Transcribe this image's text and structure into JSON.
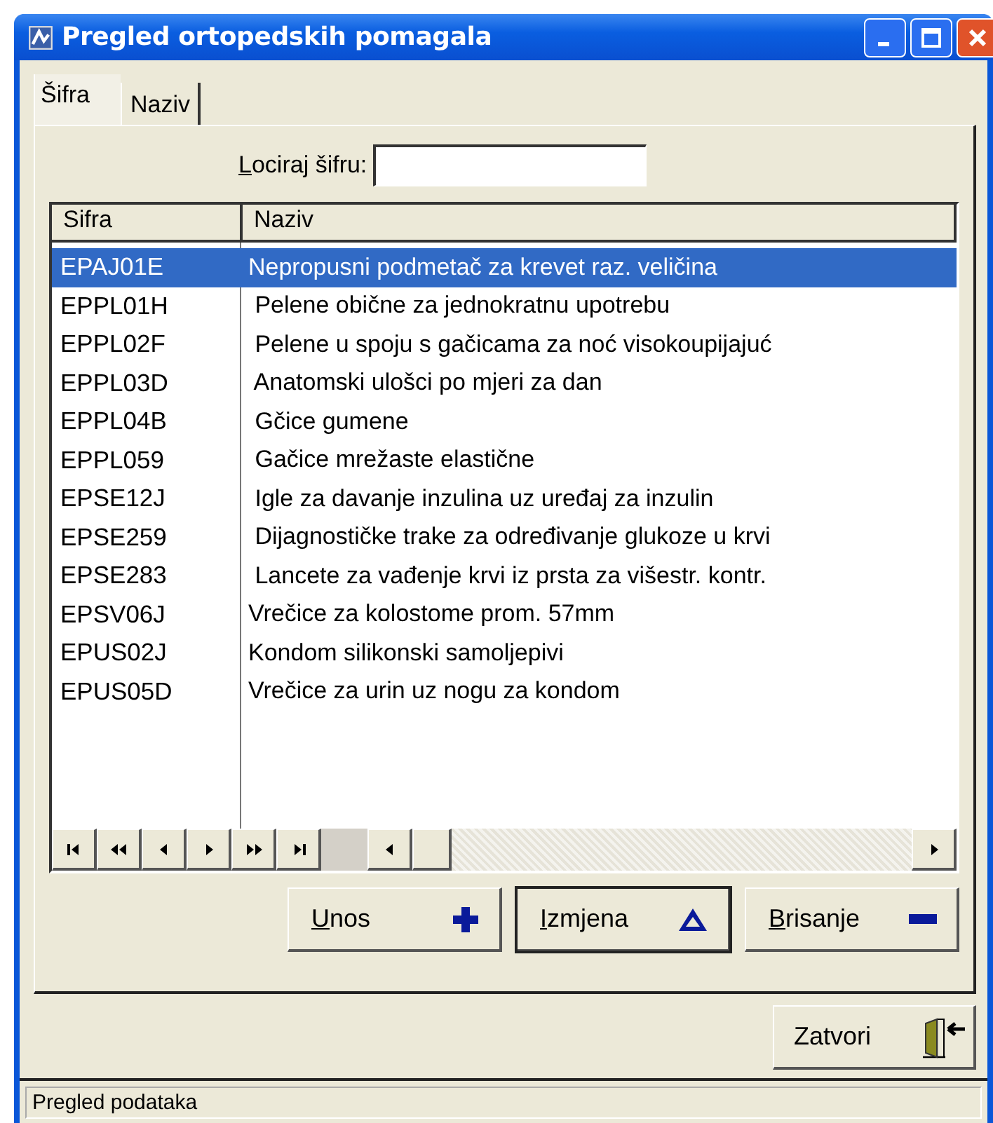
{
  "window": {
    "title": "Pregled ortopedskih pomagala"
  },
  "tabs": [
    {
      "label": "Šifra",
      "selected": true
    },
    {
      "label": "Naziv",
      "selected": false
    }
  ],
  "locate": {
    "label": "Lociraj šifru:"
  },
  "grid": {
    "columns": [
      "Sifra",
      "Naziv"
    ],
    "rows": [
      {
        "code": "EPAJ01E",
        "name": "Nepropusni podmetač za krevet raz. veličina",
        "selected": true
      },
      {
        "code": "EPPL01H",
        "name": " Pelene obične za jednokratnu upotrebu",
        "selected": false
      },
      {
        "code": "EPPL02F",
        "name": " Pelene u spoju s gačicama za noć visokoupijajuć",
        "selected": false
      },
      {
        "code": "EPPL03D",
        "name": " Anatomski ulošci po mjeri za dan",
        "selected": false
      },
      {
        "code": "EPPL04B",
        "name": " Gčice gumene",
        "selected": false
      },
      {
        "code": "EPPL059",
        "name": " Gačice mrežaste elastične",
        "selected": false
      },
      {
        "code": "EPSE12J",
        "name": " Igle za davanje inzulina uz uređaj za inzulin",
        "selected": false
      },
      {
        "code": "EPSE259",
        "name": " Dijagnostičke trake za određivanje glukoze u krvi",
        "selected": false
      },
      {
        "code": "EPSE283",
        "name": " Lancete za vađenje krvi iz prsta za višestr. kontr.",
        "selected": false
      },
      {
        "code": "EPSV06J",
        "name": "Vrečice za kolostome prom. 57mm",
        "selected": false
      },
      {
        "code": "EPUS02J",
        "name": "Kondom silikonski samoljepivi",
        "selected": false
      },
      {
        "code": "EPUS05D",
        "name": "Vrečice za urin uz nogu za kondom",
        "selected": false
      }
    ]
  },
  "buttons": [
    {
      "label": "Unos",
      "kind": "add",
      "default": false
    },
    {
      "label": "Izmjena",
      "kind": "edit",
      "default": true
    },
    {
      "label": "Brisanje",
      "kind": "delete",
      "default": false
    }
  ],
  "close_button": {
    "label": "Zatvori"
  },
  "status_bar": "Pregled podataka"
}
